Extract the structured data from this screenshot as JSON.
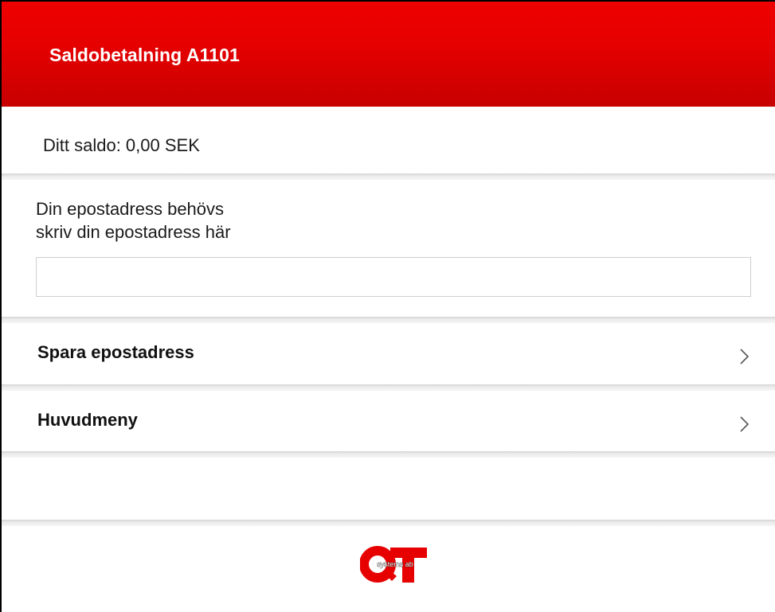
{
  "header": {
    "title": "Saldobetalning A1101"
  },
  "balance": {
    "text": "Ditt saldo: 0,00 SEK"
  },
  "email": {
    "label_line1": "Din epostadress behövs",
    "label_line2": "skriv din epostadress här",
    "value": "",
    "placeholder": ""
  },
  "menu": {
    "items": [
      {
        "label": "Spara epostadress",
        "icon": "chevron-right-icon"
      },
      {
        "label": "Huvudmeny",
        "icon": "chevron-right-icon"
      }
    ]
  },
  "logo": {
    "text": "systems ab",
    "brand": "QT",
    "color": "#e60000"
  },
  "colors": {
    "header_red": "#e60000",
    "separator": "#e4e4e4"
  }
}
